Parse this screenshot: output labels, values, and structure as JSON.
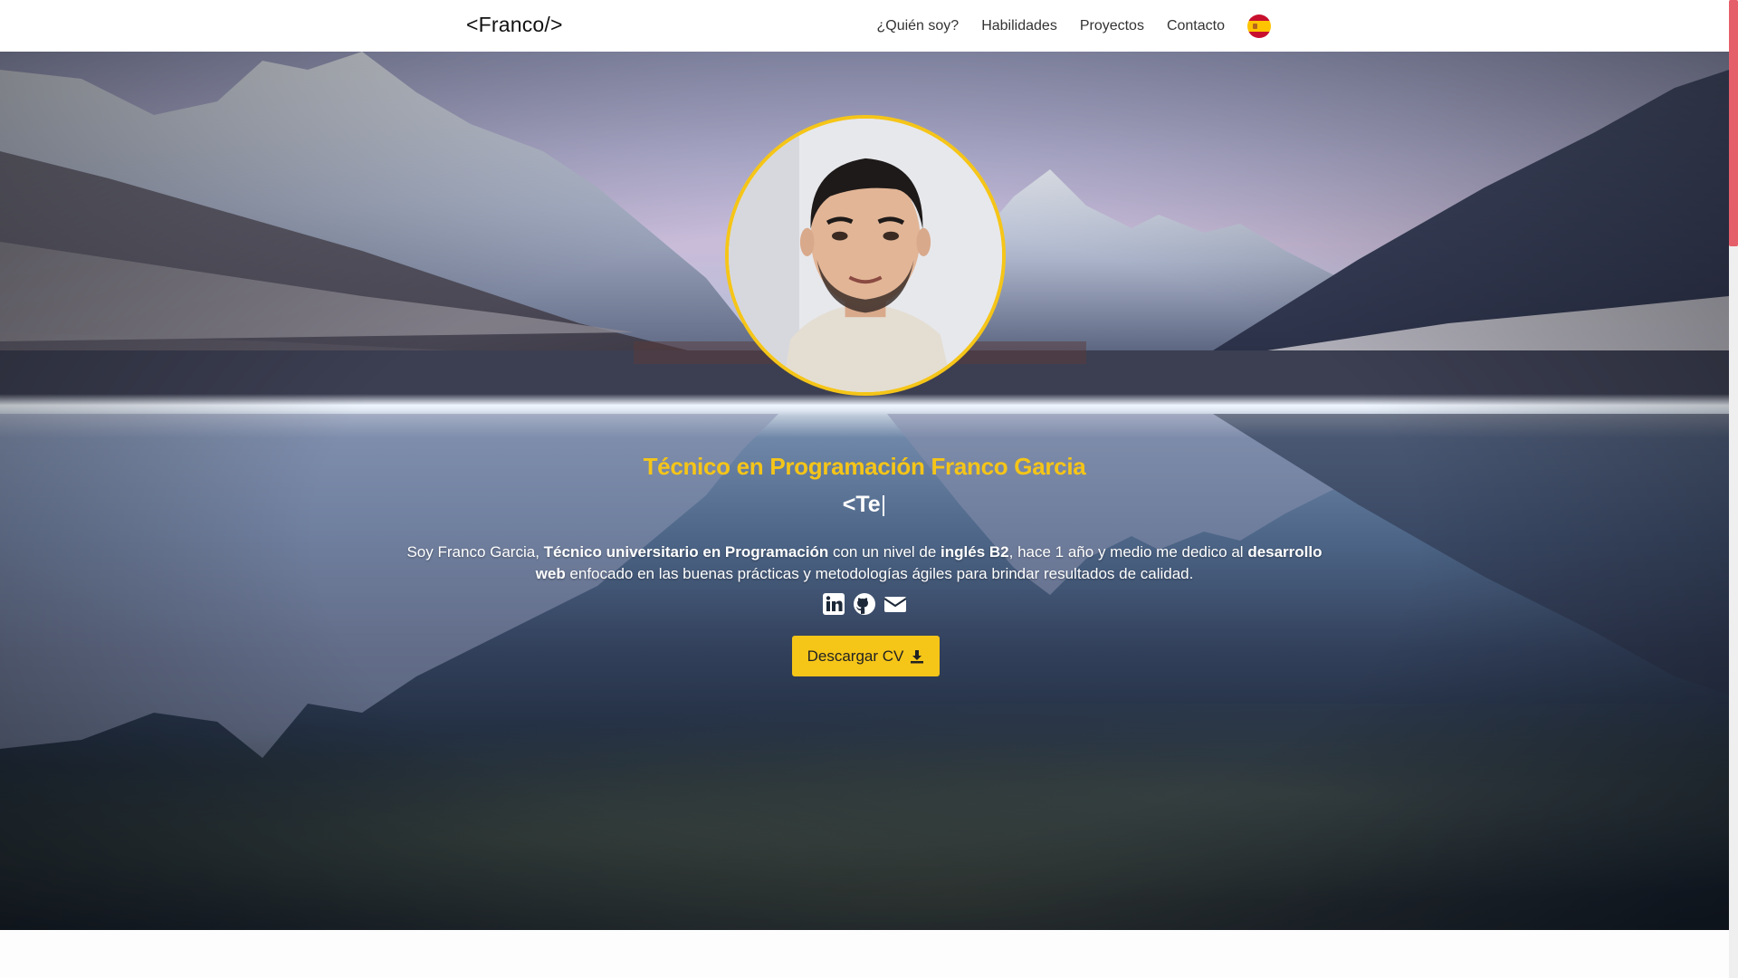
{
  "navbar": {
    "brand": "<Franco/>",
    "links": [
      "¿Quién soy?",
      "Habilidades",
      "Proyectos",
      "Contacto"
    ],
    "language_icon": "spain-flag-icon"
  },
  "hero": {
    "title": "Técnico en Programación Franco Garcia",
    "typed_text": "<Te",
    "typed_cursor": "|",
    "bio": {
      "p1": "Soy Franco Garcia, ",
      "b1": "Técnico universitario en Programación",
      "p2": " con un nivel de ",
      "b2": "inglés B2",
      "p3": ", hace 1 año y medio me dedico al ",
      "b3": "desarrollo web",
      "p4": " enfocado en las buenas prácticas y metodologías ágiles para brindar resultados de calidad."
    },
    "social_icons": [
      "linkedin-icon",
      "github-icon",
      "envelope-icon"
    ],
    "cv_button": "Descargar CV",
    "cv_icon": "download-icon"
  },
  "colors": {
    "accent": "#f5c518",
    "scroll_thumb": "#e55f6a"
  }
}
